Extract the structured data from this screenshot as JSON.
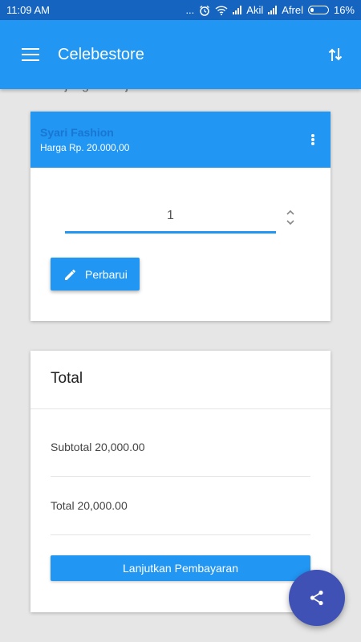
{
  "status_bar": {
    "time": "11:09 AM",
    "dots": "...",
    "carrier1": "Akil",
    "carrier2": "Afrel",
    "battery": "16%"
  },
  "app_bar": {
    "title": "Celebestore",
    "menu_icon": "hamburger-menu-icon",
    "sort_icon": "swap-vert-icon"
  },
  "cart": {
    "section_title": "Keranjang Belanja",
    "item": {
      "name": "Syari Fashion",
      "price": "Harga Rp. 20.000,00",
      "quantity": "1"
    },
    "update_label": "Perbarui"
  },
  "total": {
    "title": "Total",
    "subtotal": "Subtotal 20,000.00",
    "total": "Total 20,000.00",
    "checkout_label": "Lanjutkan Pembayaran"
  },
  "colors": {
    "primary": "#2196f3",
    "status_bar": "#1565c0",
    "fab": "#3f51b5",
    "background": "#e6e6e6"
  }
}
